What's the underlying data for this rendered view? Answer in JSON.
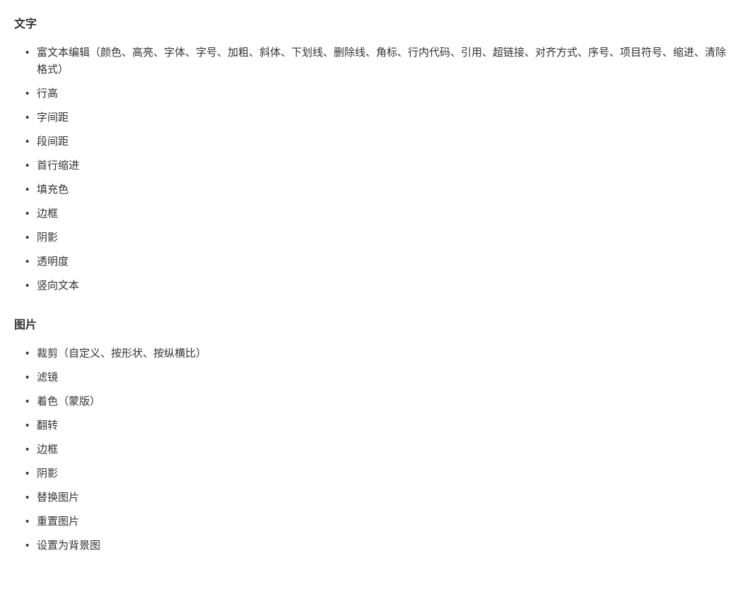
{
  "sections": [
    {
      "title": "文字",
      "items": [
        "富文本编辑（颜色、高亮、字体、字号、加粗、斜体、下划线、删除线、角标、行内代码、引用、超链接、对齐方式、序号、项目符号、缩进、清除格式）",
        "行高",
        "字间距",
        "段间距",
        "首行缩进",
        "填充色",
        "边框",
        "阴影",
        "透明度",
        "竖向文本"
      ]
    },
    {
      "title": "图片",
      "items": [
        "裁剪（自定义、按形状、按纵横比）",
        "滤镜",
        "着色（蒙版）",
        "翻转",
        "边框",
        "阴影",
        "替换图片",
        "重置图片",
        "设置为背景图"
      ]
    }
  ]
}
